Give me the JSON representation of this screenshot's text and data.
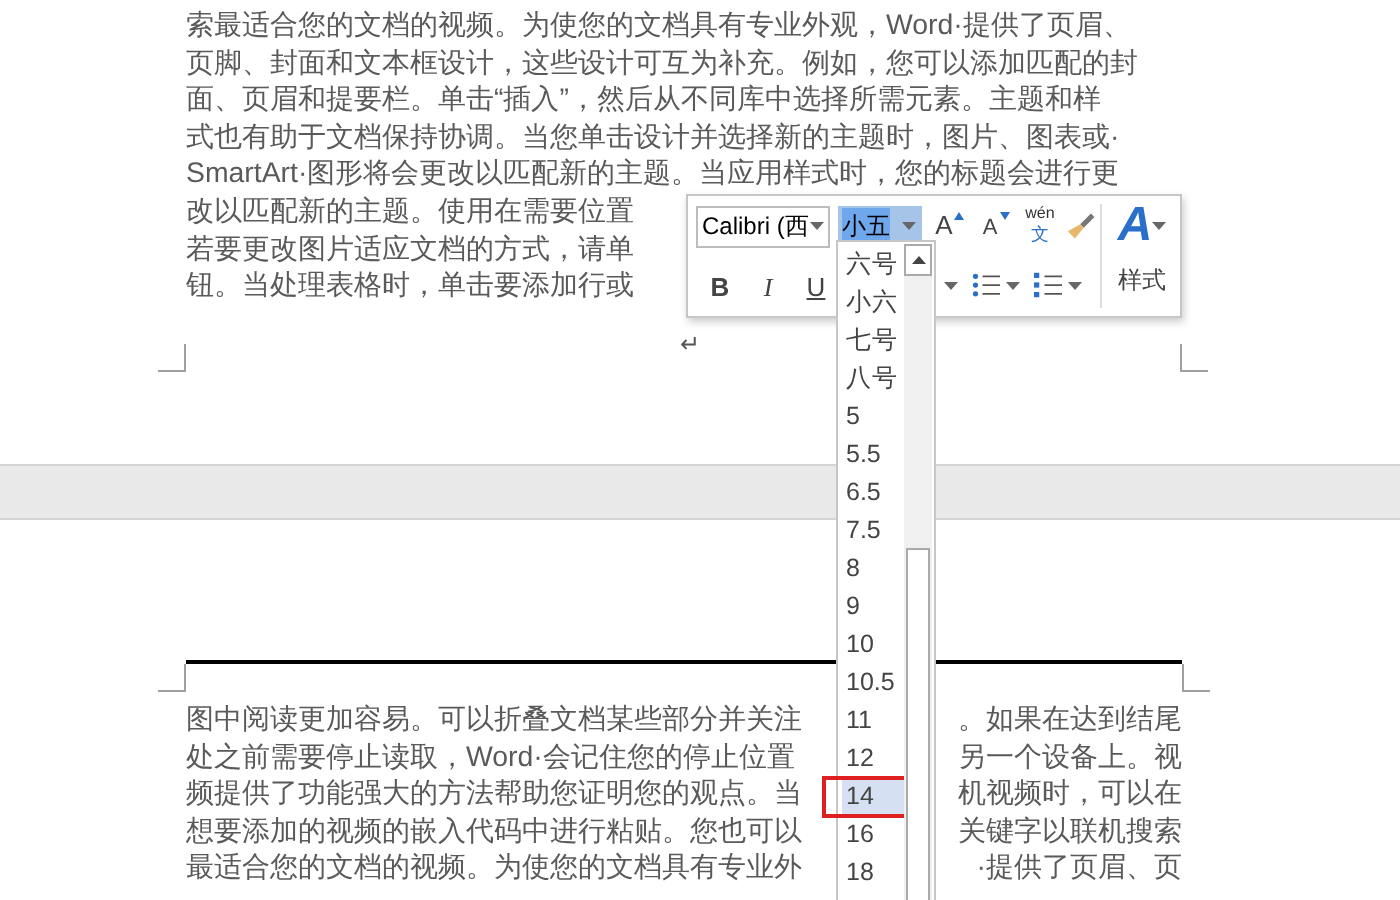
{
  "page_1": {
    "lines": [
      {
        "segments": [
          "索最适合您的文档的视频。为使您的文档具有专业外观，Word·提供了页眉、"
        ]
      },
      {
        "segments": [
          "页脚、封面和文本框设计，这些设计可互为补充。例如，您可以添加匹配的封"
        ]
      },
      {
        "segments": [
          "面、页眉和提要栏。单击“插入”，然后从不同库中选择所需元素。主题和样"
        ]
      },
      {
        "segments": [
          "式也有助于文档保持协调。当您单击设计并选择新的主题时，图片、图表或·"
        ]
      },
      {
        "segments": [
          "SmartArt·图形将会更改以匹配新的主题。当应用样式时，您的标题会进行更"
        ]
      },
      {
        "segments": [
          "改以匹配新的主题。使用在需要位置"
        ]
      },
      {
        "segments": [
          "若要更改图片适应文档的方式，请单"
        ]
      },
      {
        "segments": [
          "钮。当处理表格时，单击要添加行或"
        ]
      }
    ],
    "paragraph_mark": "↵"
  },
  "page_2": {
    "lines": [
      {
        "segments": [
          "图中阅读更加容易。可以折叠文档某些部分并关注",
          "。如果在达到结尾"
        ]
      },
      {
        "segments": [
          "处之前需要停止读取，Word·会记住您的停止位置",
          "另一个设备上。视"
        ]
      },
      {
        "segments": [
          "频提供了功能强大的方法帮助您证明您的观点。当",
          "机视频时，可以在"
        ]
      },
      {
        "segments": [
          "想要添加的视频的嵌入代码中进行粘贴。您也可以",
          "关键字以联机搜索"
        ]
      },
      {
        "segments": [
          "最适合您的文档的视频。为使您的文档具有专业外",
          "·提供了页眉、页"
        ]
      }
    ]
  },
  "mini_toolbar": {
    "font_field": {
      "value": "Calibri (西"
    },
    "size_field": {
      "value": "小五",
      "selected": true
    },
    "grow_font": "A",
    "shrink_font": "A",
    "phonetic_guide": {
      "pinyin": "wén",
      "char": "文"
    },
    "styles": {
      "glyph": "A",
      "label": "样式"
    },
    "format_buttons": [
      "B",
      "I",
      "U"
    ]
  },
  "size_dropdown": {
    "items": [
      {
        "label": "六号",
        "selected": false,
        "annotated": false
      },
      {
        "label": "小六",
        "selected": false,
        "annotated": false
      },
      {
        "label": "七号",
        "selected": false,
        "annotated": false
      },
      {
        "label": "八号",
        "selected": false,
        "annotated": false
      },
      {
        "label": "5",
        "selected": false,
        "annotated": false
      },
      {
        "label": "5.5",
        "selected": false,
        "annotated": false
      },
      {
        "label": "6.5",
        "selected": false,
        "annotated": false
      },
      {
        "label": "7.5",
        "selected": false,
        "annotated": false
      },
      {
        "label": "8",
        "selected": false,
        "annotated": false
      },
      {
        "label": "9",
        "selected": false,
        "annotated": false
      },
      {
        "label": "10",
        "selected": false,
        "annotated": false
      },
      {
        "label": "10.5",
        "selected": false,
        "annotated": false
      },
      {
        "label": "11",
        "selected": false,
        "annotated": false
      },
      {
        "label": "12",
        "selected": false,
        "annotated": false
      },
      {
        "label": "14",
        "selected": true,
        "annotated": true
      },
      {
        "label": "16",
        "selected": false,
        "annotated": false
      },
      {
        "label": "18",
        "selected": false,
        "annotated": false
      }
    ]
  }
}
